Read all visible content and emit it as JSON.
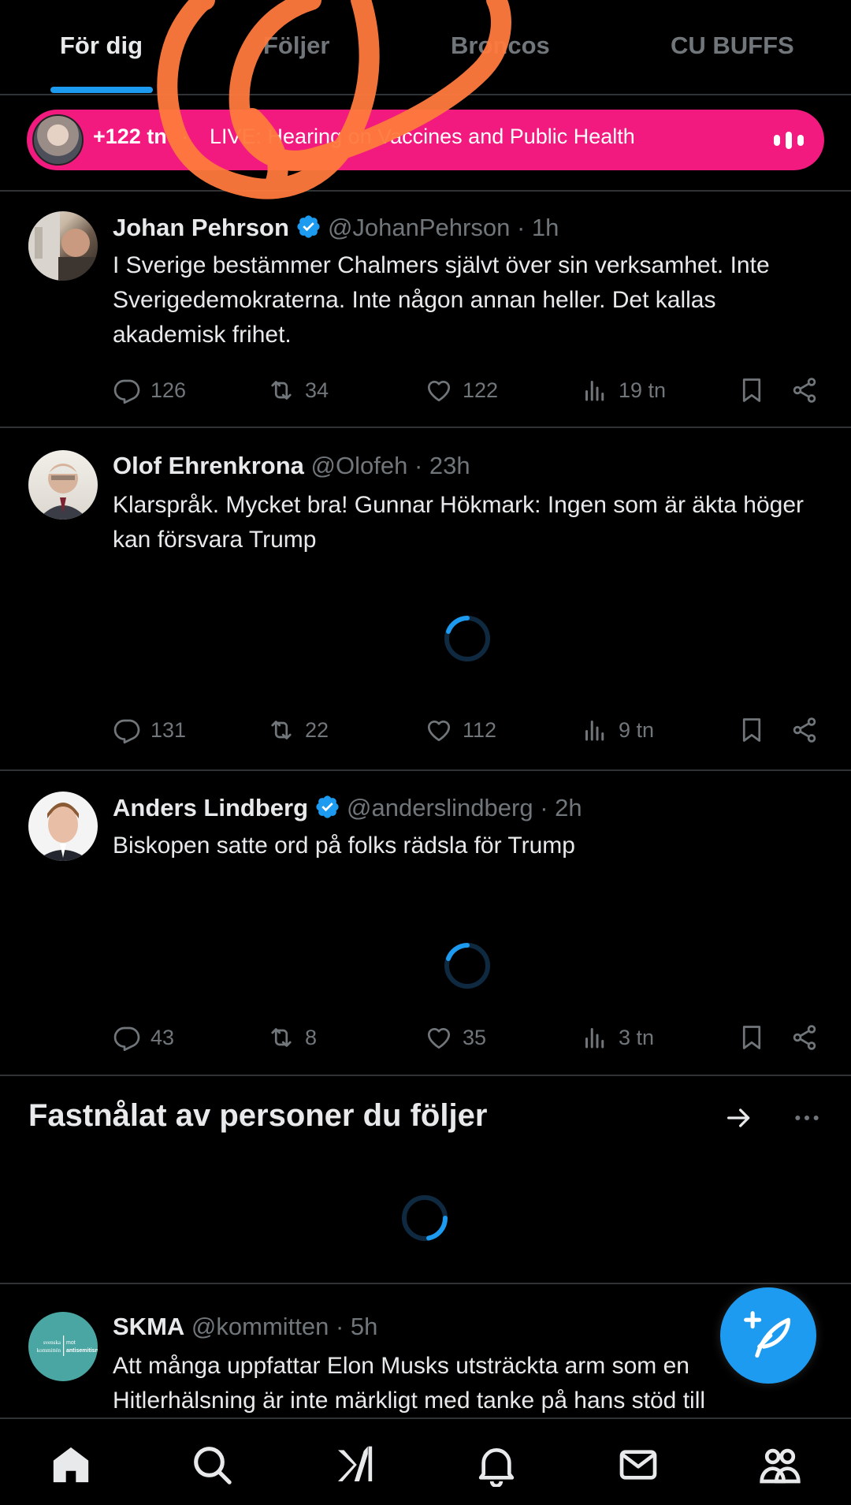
{
  "tabs": [
    {
      "label": "För dig",
      "active": true
    },
    {
      "label": "Följer",
      "active": false
    },
    {
      "label": "Broncos",
      "active": false
    },
    {
      "label": "CU BUFFS",
      "active": false
    }
  ],
  "live_banner": {
    "count": "+122 tn",
    "separator": "·",
    "title": "LIVE: Hearing on Vaccines and Public Health",
    "title_visible": "e on Vaccines and Public Health",
    "color": "#f2197f"
  },
  "tweets": [
    {
      "name": "Johan Pehrson",
      "verified": true,
      "handle": "@JohanPehrson",
      "time": "· 1h",
      "text": "I Sverige bestämmer Chalmers självt över sin verksamhet. Inte Sverigedemokraterna. Inte någon annan heller. Det kallas akademisk frihet.",
      "replies": "126",
      "reposts": "34",
      "likes": "122",
      "views": "19 tn"
    },
    {
      "name": "Olof Ehrenkrona",
      "verified": false,
      "handle": "@Olofeh",
      "time": "· 23h",
      "text": "Klarspråk. Mycket bra! Gunnar Hökmark: Ingen som är äkta höger kan försvara Trump",
      "replies": "131",
      "reposts": "22",
      "likes": "112",
      "views": "9 tn"
    },
    {
      "name": "Anders Lindberg",
      "verified": true,
      "handle": "@anderslindberg",
      "time": "· 2h",
      "text": "Biskopen satte ord på folks rädsla för Trump",
      "replies": "43",
      "reposts": "8",
      "likes": "35",
      "views": "3 tn"
    },
    {
      "name": "SKMA",
      "verified": false,
      "handle": "@kommitten",
      "time": "· 5h",
      "text": "Att många uppfattar Elon Musks utsträckta arm som en Hitlerhälsning är inte märkligt med tanke på hans stöd till",
      "avatar_text": "svenska kommittén mot antisemitism"
    }
  ],
  "pinned_section": {
    "title": "Fastnålat av personer du följer"
  },
  "icons": {
    "reply": "reply-icon",
    "repost": "repost-icon",
    "like": "heart-icon",
    "views": "views-icon",
    "bookmark": "bookmark-icon",
    "share": "share-icon",
    "compose": "compose-icon"
  },
  "nav": [
    "home-icon",
    "search-icon",
    "grok-icon",
    "bell-icon",
    "mail-icon",
    "communities-icon"
  ],
  "colors": {
    "accent": "#1d9bf0",
    "background": "#000000",
    "text": "#e7e9ea",
    "muted": "#71767b",
    "live": "#f2197f",
    "annotation": "#ff7a3d"
  }
}
